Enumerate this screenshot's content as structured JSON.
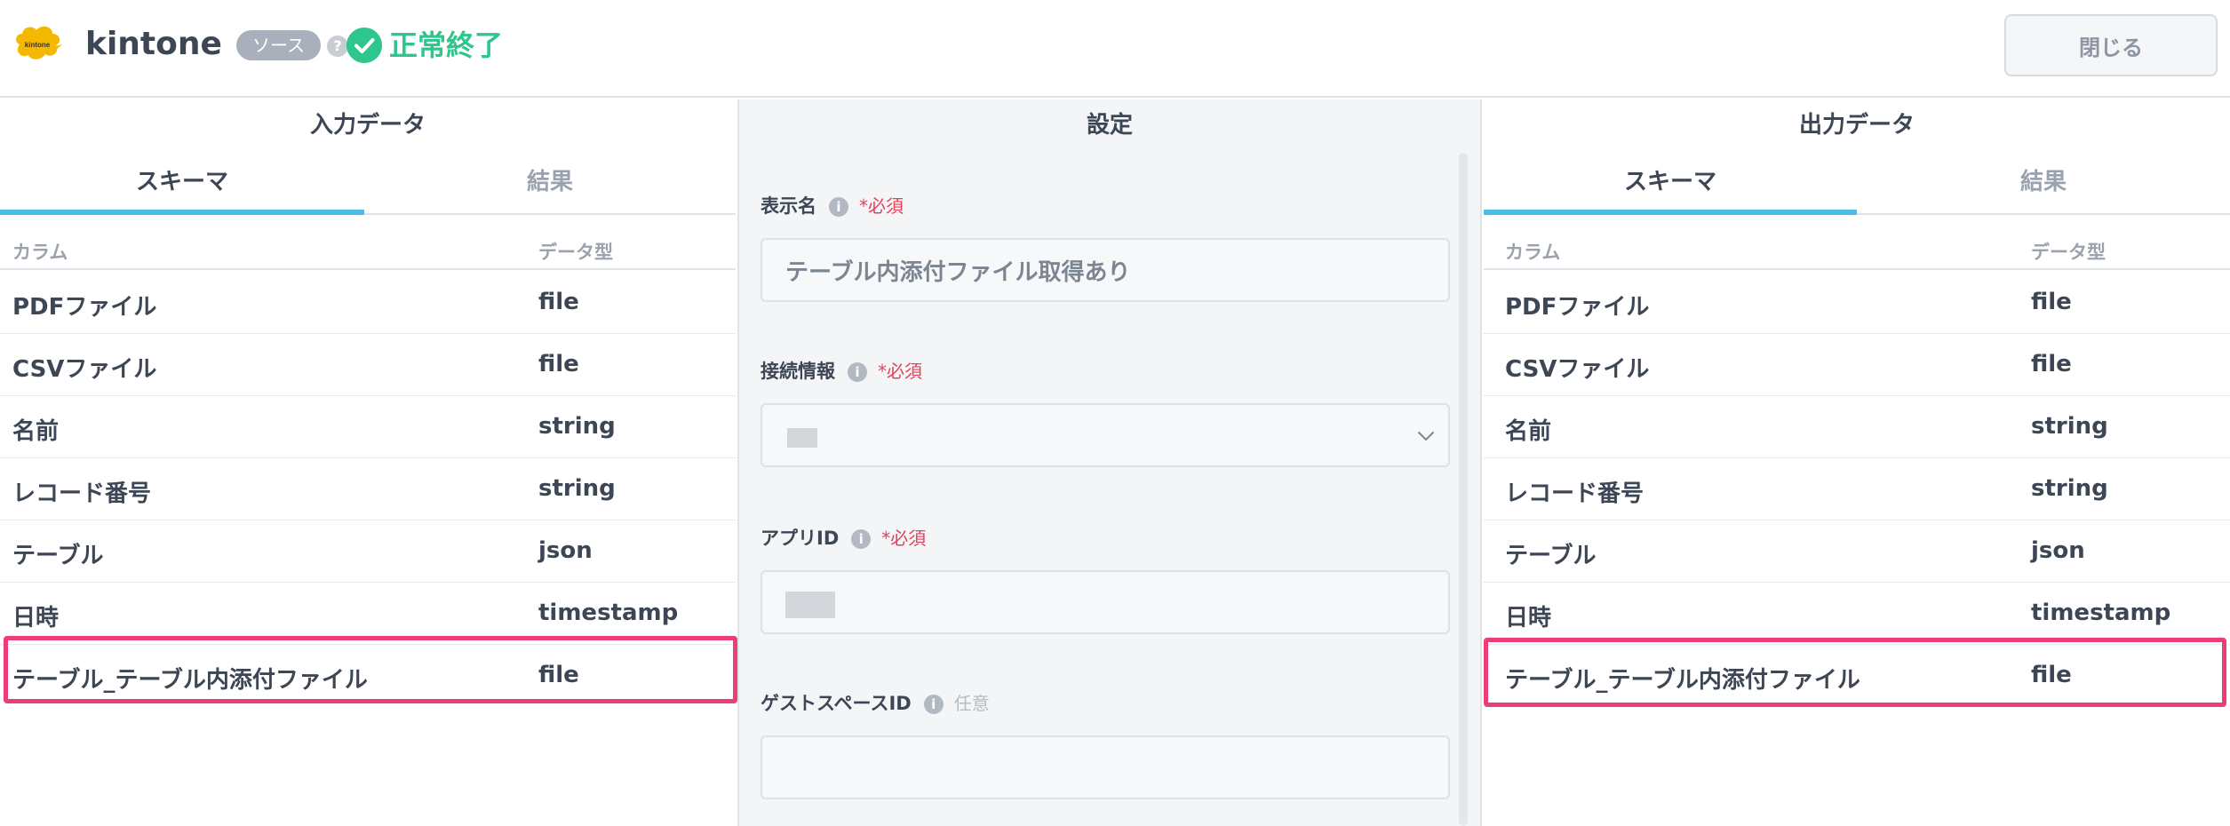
{
  "header": {
    "logo_text": "kintone",
    "app_name": "kintone",
    "source_badge": "ソース",
    "help_glyph": "?",
    "status": "正常終了",
    "close_label": "閉じる"
  },
  "input_panel": {
    "title": "入力データ",
    "tabs": [
      {
        "label": "スキーマ",
        "active": true
      },
      {
        "label": "結果",
        "active": false
      }
    ],
    "columns": {
      "name": "カラム",
      "type": "データ型"
    },
    "rows": [
      {
        "name": "PDFファイル",
        "type": "file"
      },
      {
        "name": "CSVファイル",
        "type": "file"
      },
      {
        "name": "名前",
        "type": "string"
      },
      {
        "name": "レコード番号",
        "type": "string"
      },
      {
        "name": "テーブル",
        "type": "json"
      },
      {
        "name": "日時",
        "type": "timestamp"
      },
      {
        "name": "テーブル_テーブル内添付ファイル",
        "type": "file",
        "highlighted": true
      }
    ]
  },
  "settings_panel": {
    "title": "設定",
    "fields": {
      "display_name": {
        "label": "表示名",
        "required": "*必須",
        "value": "テーブル内添付ファイル取得あり"
      },
      "connection": {
        "label": "接続情報",
        "required": "*必須"
      },
      "app_id": {
        "label": "アプリID",
        "required": "*必須"
      },
      "guest_space_id": {
        "label": "ゲストスペースID",
        "optional": "任意",
        "value": ""
      }
    }
  },
  "output_panel": {
    "title": "出力データ",
    "tabs": [
      {
        "label": "スキーマ",
        "active": true
      },
      {
        "label": "結果",
        "active": false
      }
    ],
    "columns": {
      "name": "カラム",
      "type": "データ型"
    },
    "rows": [
      {
        "name": "PDFファイル",
        "type": "file"
      },
      {
        "name": "CSVファイル",
        "type": "file"
      },
      {
        "name": "名前",
        "type": "string"
      },
      {
        "name": "レコード番号",
        "type": "string"
      },
      {
        "name": "テーブル",
        "type": "json"
      },
      {
        "name": "日時",
        "type": "timestamp"
      },
      {
        "name": "テーブル_テーブル内添付ファイル",
        "type": "file",
        "highlighted": true
      }
    ]
  },
  "icons": {
    "logo": "kintone-logo-icon",
    "status": "check-circle-icon",
    "info": "info-icon",
    "dropdown": "chevron-down-icon"
  },
  "colors": {
    "accent": "#4bbde8",
    "success": "#2fc68e",
    "required": "#e0435b",
    "highlight": "#ec3c7a"
  }
}
